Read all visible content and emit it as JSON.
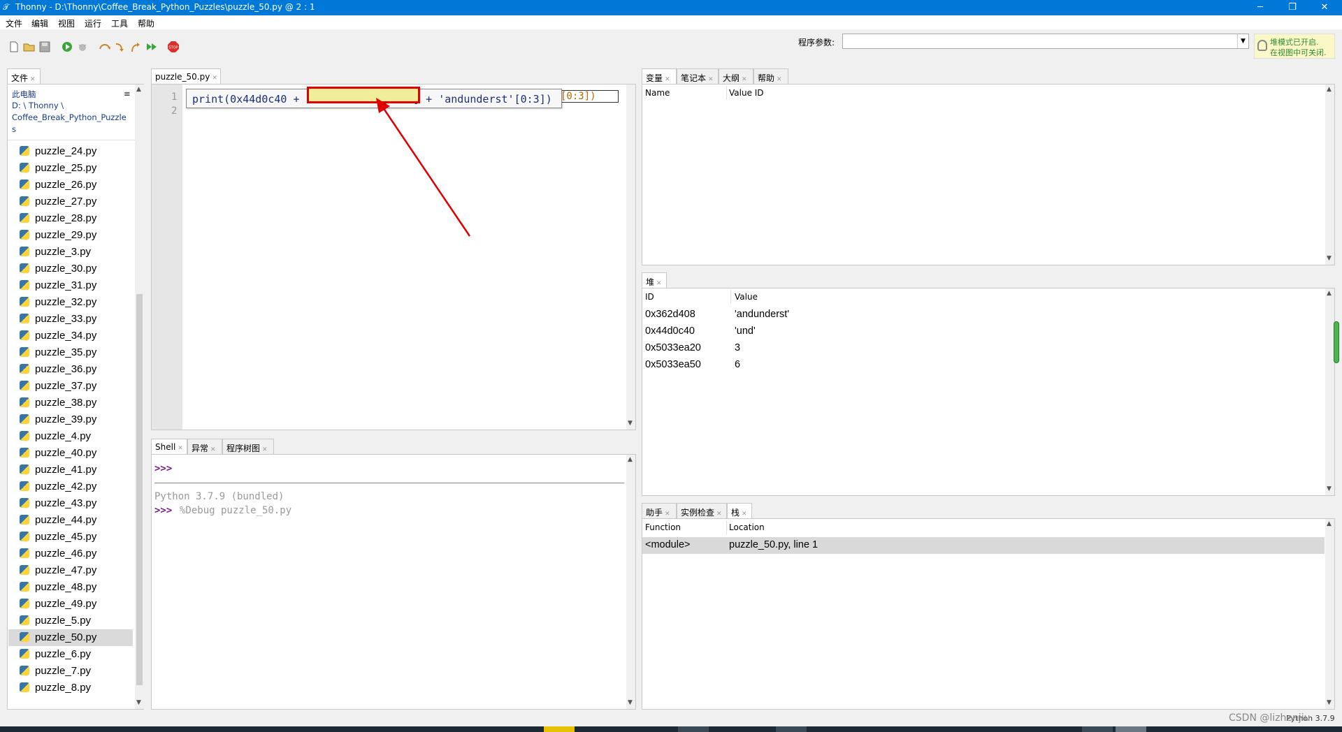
{
  "titlebar": {
    "title": "Thonny  -  D:\\Thonny\\Coffee_Break_Python_Puzzles\\puzzle_50.py  @  2 : 1",
    "minimize": "─",
    "maximize": "❐",
    "close": "✕"
  },
  "menu": [
    "文件",
    "编辑",
    "视图",
    "运行",
    "工具",
    "帮助"
  ],
  "toolbar": {
    "args_label": "程序参数:",
    "args_value": "",
    "hint_line1": "堆模式已开启.",
    "hint_line2": "在视图中可关闭."
  },
  "files": {
    "tab": "文件",
    "location_label": "此电脑",
    "path_line1": "D: \\ Thonny \\",
    "path_line2": "Coffee_Break_Python_Puzzle",
    "path_line3": "s",
    "items": [
      "puzzle_24.py",
      "puzzle_25.py",
      "puzzle_26.py",
      "puzzle_27.py",
      "puzzle_28.py",
      "puzzle_29.py",
      "puzzle_3.py",
      "puzzle_30.py",
      "puzzle_31.py",
      "puzzle_32.py",
      "puzzle_33.py",
      "puzzle_34.py",
      "puzzle_35.py",
      "puzzle_36.py",
      "puzzle_37.py",
      "puzzle_38.py",
      "puzzle_39.py",
      "puzzle_4.py",
      "puzzle_40.py",
      "puzzle_41.py",
      "puzzle_42.py",
      "puzzle_43.py",
      "puzzle_44.py",
      "puzzle_45.py",
      "puzzle_46.py",
      "puzzle_47.py",
      "puzzle_48.py",
      "puzzle_49.py",
      "puzzle_5.py",
      "puzzle_50.py",
      "puzzle_6.py",
      "puzzle_7.py",
      "puzzle_8.py"
    ],
    "selected": "puzzle_50.py"
  },
  "editor": {
    "tab": "puzzle_50.py",
    "line_numbers": [
      "1",
      "2"
    ],
    "code_popup": "print(0x44d0c40 + 'andunderst'[6:10] + 'andunderst'[0:3])",
    "code_tail": "[0:3])"
  },
  "shell": {
    "tabs": [
      "Shell",
      "异常",
      "程序树图"
    ],
    "prompt": ">>>",
    "banner": "Python 3.7.9 (bundled)",
    "command": "%Debug puzzle_50.py"
  },
  "variables": {
    "tabs": [
      "变量",
      "笔记本",
      "大纲",
      "帮助"
    ],
    "col_name": "Name",
    "col_value": "Value ID"
  },
  "heap": {
    "tab": "堆",
    "col_id": "ID",
    "col_value": "Value",
    "rows": [
      {
        "id": "0x362d408",
        "value": "'andunderst'"
      },
      {
        "id": "0x44d0c40",
        "value": "'und'"
      },
      {
        "id": "0x5033ea20",
        "value": "3"
      },
      {
        "id": "0x5033ea50",
        "value": "6"
      }
    ]
  },
  "stack": {
    "tabs": [
      "助手",
      "实例检查",
      "栈"
    ],
    "col_function": "Function",
    "col_location": "Location",
    "rows": [
      {
        "function": "<module>",
        "location": "puzzle_50.py, line 1"
      }
    ]
  },
  "status": {
    "interpreter": "Python 3.7.9"
  },
  "watermark": "CSDN @lizhenjiu"
}
